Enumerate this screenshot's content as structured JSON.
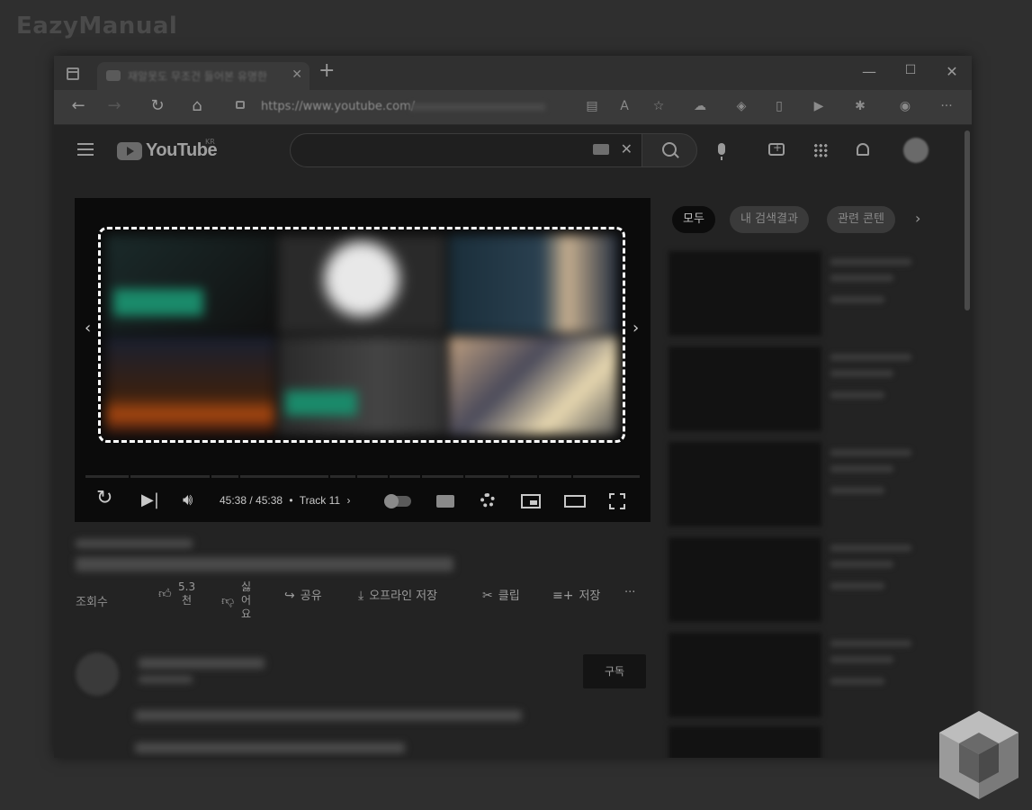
{
  "watermark": "EazyManual",
  "browser": {
    "tab_title": "재알못도 무조건 들어본 유명한",
    "url": "https://www.youtube.com/"
  },
  "youtube": {
    "logo_text": "YouTube",
    "logo_country": "KR",
    "search": {
      "value": "",
      "placeholder": ""
    }
  },
  "player": {
    "time": "45:38 / 45:38",
    "separator": "•",
    "chapter": "Track 11",
    "highlight_color": "#ffffff"
  },
  "actions": {
    "views_label": "조회수",
    "likes_count": "5.3",
    "likes_unit": "천",
    "dislike_1": "싫",
    "dislike_2": "어",
    "dislike_3": "요",
    "share": "공유",
    "download": "오프라인 저장",
    "clip": "클립",
    "save": "저장",
    "more": "···"
  },
  "channel": {
    "subscribe": "구독"
  },
  "sidebar": {
    "chips": [
      "모두",
      "내 검색결과",
      "관련 콘텐"
    ]
  }
}
